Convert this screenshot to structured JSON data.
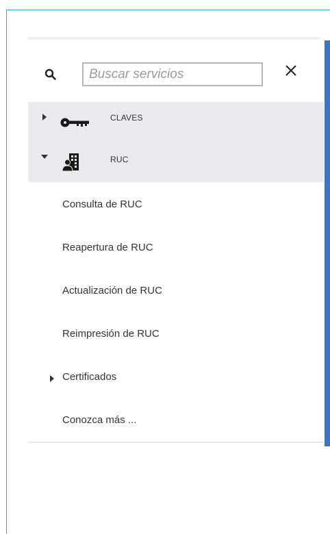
{
  "search": {
    "placeholder": "Buscar servicios",
    "value": ""
  },
  "menu": {
    "categories": [
      {
        "label": "CLAVES",
        "icon": "key-icon",
        "expanded": false
      },
      {
        "label": "RUC",
        "icon": "building-user-icon",
        "expanded": true
      }
    ],
    "ruc_items": [
      {
        "label": "Consulta de RUC"
      },
      {
        "label": "Reapertura de RUC"
      },
      {
        "label": "Actualización de RUC"
      },
      {
        "label": "Reimpresión de RUC"
      },
      {
        "label": "Certificados",
        "expandable": true,
        "expanded": false
      },
      {
        "label": "Conozca más ..."
      }
    ]
  },
  "colors": {
    "frame_border": "#29b6d6",
    "scroll_accent": "#3d74c4",
    "category_bg": "#e8eaed"
  }
}
